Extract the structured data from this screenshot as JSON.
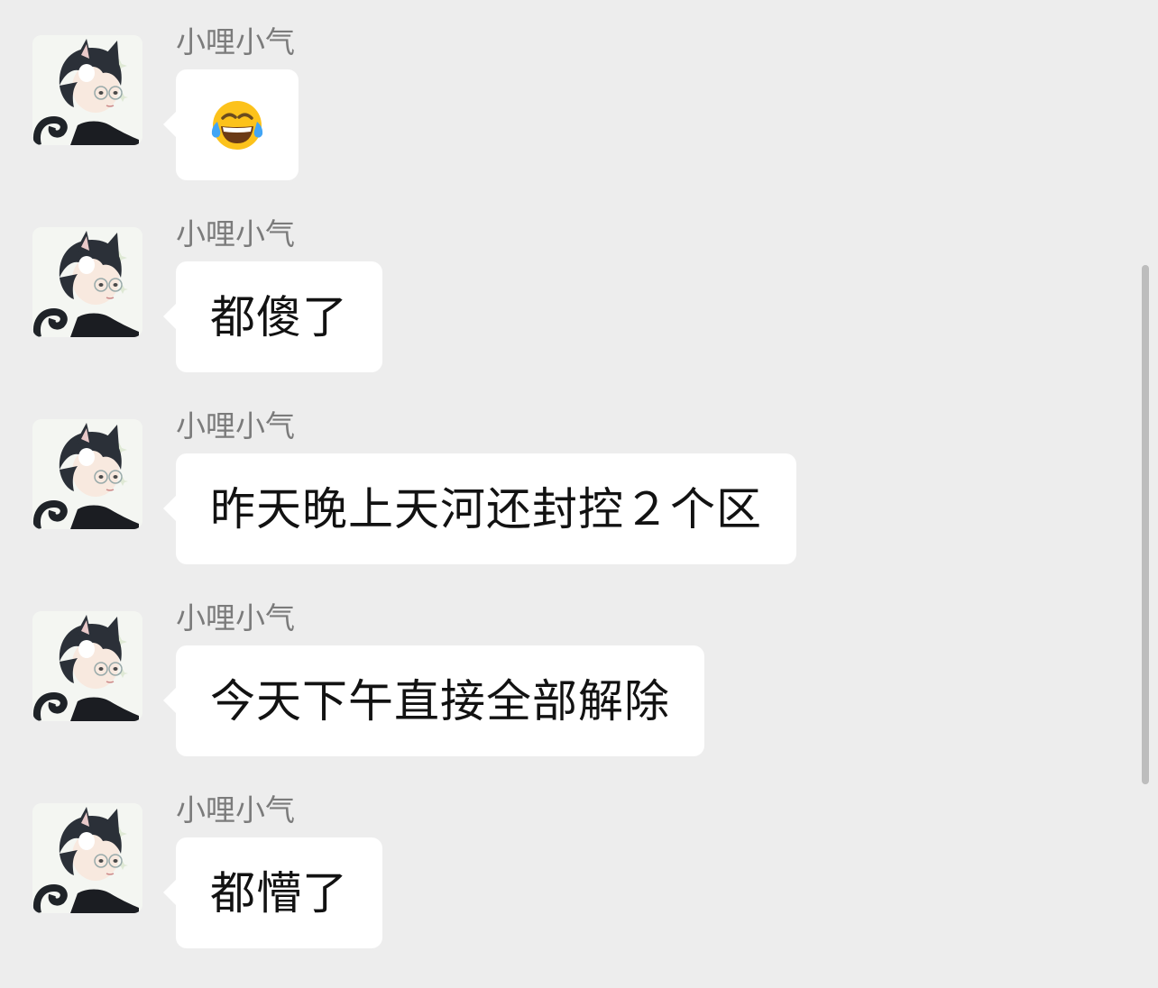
{
  "messages": [
    {
      "sender": "小哩小气",
      "type": "emoji",
      "emoji": "face-with-tears-of-joy-icon"
    },
    {
      "sender": "小哩小气",
      "type": "text",
      "text": "都傻了"
    },
    {
      "sender": "小哩小气",
      "type": "text",
      "text": "昨天晚上天河还封控２个区"
    },
    {
      "sender": "小哩小气",
      "type": "text",
      "text": "今天下午直接全部解除"
    },
    {
      "sender": "小哩小气",
      "type": "text",
      "text": "都懵了"
    }
  ],
  "colors": {
    "background": "#ededed",
    "bubble": "#ffffff",
    "sender_text": "#7b7b7b",
    "message_text": "#121212"
  }
}
